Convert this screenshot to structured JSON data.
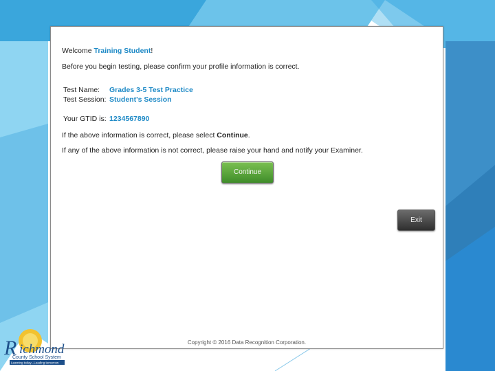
{
  "welcome": {
    "prefix": "Welcome ",
    "name": "Training Student",
    "suffix": "!"
  },
  "confirm_text": "Before you begin testing, please confirm your profile information is correct.",
  "test_name": {
    "label": "Test Name:",
    "value": "Grades 3-5 Test Practice"
  },
  "test_session": {
    "label": "Test Session:",
    "value": "Student's Session"
  },
  "gtid": {
    "label": "Your GTID is:",
    "value": "1234567890"
  },
  "correct_text": {
    "prefix": "If the above information is correct, please select ",
    "emphasis": "Continue",
    "suffix": "."
  },
  "incorrect_text": "If any of the above information is not correct, please raise your hand and notify your Examiner.",
  "buttons": {
    "continue": "Continue",
    "exit": "Exit"
  },
  "copyright": "Copyright © 2016 Data Recognition Corporation.",
  "logo": {
    "text": "Richmond",
    "subtitle": "County School System",
    "tagline": "Learning today...Leading tomorrow"
  },
  "colors": {
    "accent": "#1f8ac6",
    "continue_green": "#4e9b34",
    "exit_gray": "#3e3e3e",
    "slide_blue": "#2e8ccf"
  }
}
